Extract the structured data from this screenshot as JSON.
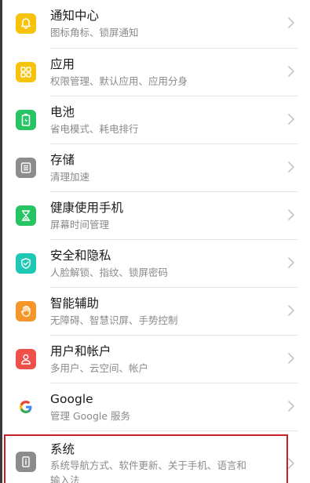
{
  "settings": {
    "items": [
      {
        "title": "通知中心",
        "subtitle": "图标角标、锁屏通知",
        "icon": "bell-icon",
        "color": "#F7C20A"
      },
      {
        "title": "应用",
        "subtitle": "权限管理、默认应用、应用分身",
        "icon": "apps-grid-icon",
        "color": "#F7C20A"
      },
      {
        "title": "电池",
        "subtitle": "省电模式、耗电排行",
        "icon": "battery-icon",
        "color": "#27C464"
      },
      {
        "title": "存储",
        "subtitle": "清理加速",
        "icon": "storage-icon",
        "color": "#8C8C8C"
      },
      {
        "title": "健康使用手机",
        "subtitle": "屏幕时间管理",
        "icon": "hourglass-icon",
        "color": "#27C464"
      },
      {
        "title": "安全和隐私",
        "subtitle": "人脸解锁、指纹、锁屏密码",
        "icon": "shield-icon",
        "color": "#1EC8B4"
      },
      {
        "title": "智能辅助",
        "subtitle": "无障碍、智慧识屏、手势控制",
        "icon": "hand-icon",
        "color": "#F5962A"
      },
      {
        "title": "用户和帐户",
        "subtitle": "多用户、云空间、帐户",
        "icon": "user-icon",
        "color": "#F0504A"
      },
      {
        "title": "Google",
        "subtitle": "管理 Google 服务",
        "icon": "google-icon",
        "color": "#FFFFFF"
      },
      {
        "title": "系统",
        "subtitle": "系统导航方式、软件更新、关于手机、语言和",
        "subtitle2": "输入法",
        "icon": "system-info-icon",
        "color": "#8C8C8C"
      }
    ]
  }
}
